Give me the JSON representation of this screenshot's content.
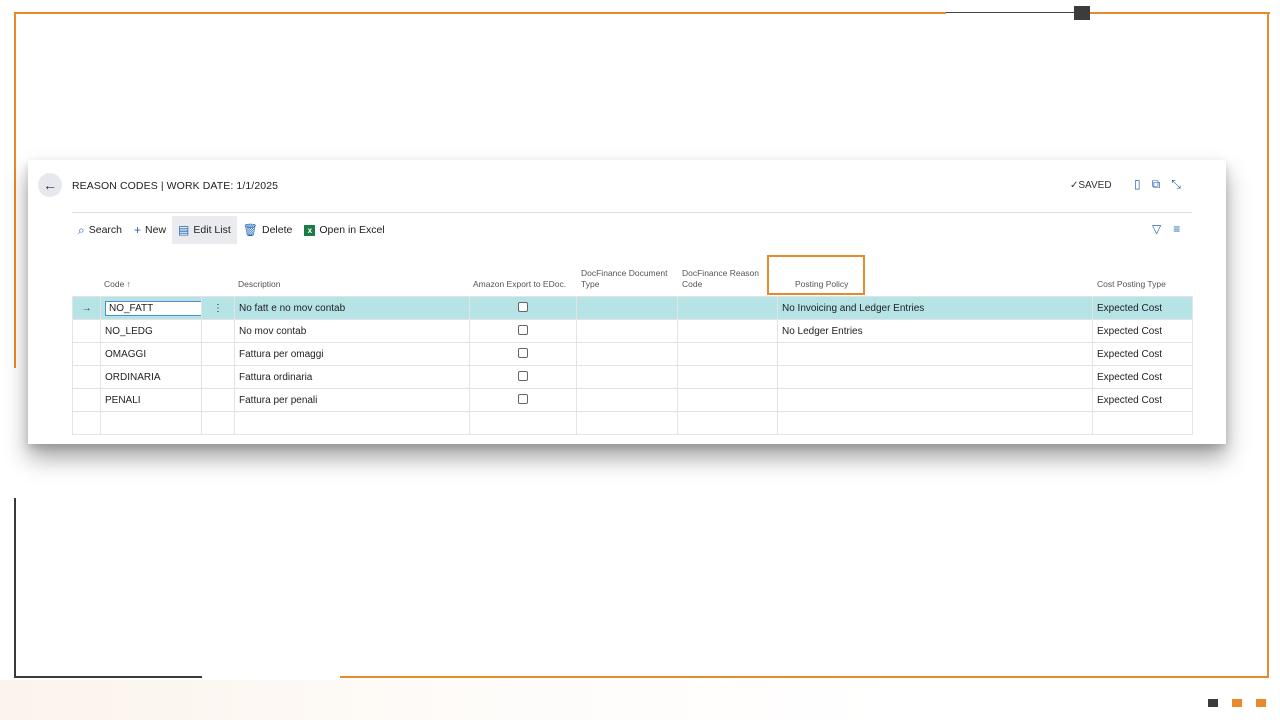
{
  "page": {
    "title": "REASON CODES | WORK DATE: 1/1/2025",
    "saved_label": "✓SAVED"
  },
  "toolbar": {
    "search": "Search",
    "new": "New",
    "edit_list": "Edit List",
    "delete": "Delete",
    "open_excel": "Open in Excel"
  },
  "columns": {
    "code": "Code ↑",
    "description": "Description",
    "amazon": "Amazon Export to EDoc.",
    "docfin_doc_1": "DocFinance Document",
    "docfin_doc_2": "Type",
    "docfin_reason_1": "DocFinance Reason",
    "docfin_reason_2": "Code",
    "posting_policy": "Posting Policy",
    "cost_posting": "Cost Posting Type"
  },
  "rows": [
    {
      "code": "NO_FATT",
      "description": "No fatt e no mov contab",
      "posting_policy": "No Invoicing and Ledger Entries",
      "cost_posting": "Expected Cost"
    },
    {
      "code": "NO_LEDG",
      "description": "No mov contab",
      "posting_policy": "No Ledger Entries",
      "cost_posting": "Expected Cost"
    },
    {
      "code": "OMAGGI",
      "description": "Fattura per omaggi",
      "posting_policy": "",
      "cost_posting": "Expected Cost"
    },
    {
      "code": "ORDINARIA",
      "description": "Fattura ordinaria",
      "posting_policy": "",
      "cost_posting": "Expected Cost"
    },
    {
      "code": "PENALI",
      "description": "Fattura per penali",
      "posting_policy": "",
      "cost_posting": "Expected Cost"
    }
  ],
  "colors": {
    "accent": "#e8892c",
    "selected_row": "#b5e3e6",
    "dark": "#3c3c3c"
  },
  "icons": [
    "back-arrow-icon",
    "bookmark-icon",
    "open-new-window-icon",
    "collapse-icon",
    "search-icon",
    "plus-icon",
    "edit-list-icon",
    "trash-icon",
    "excel-icon",
    "filter-icon",
    "list-icon",
    "row-arrow-icon",
    "more-icon"
  ]
}
